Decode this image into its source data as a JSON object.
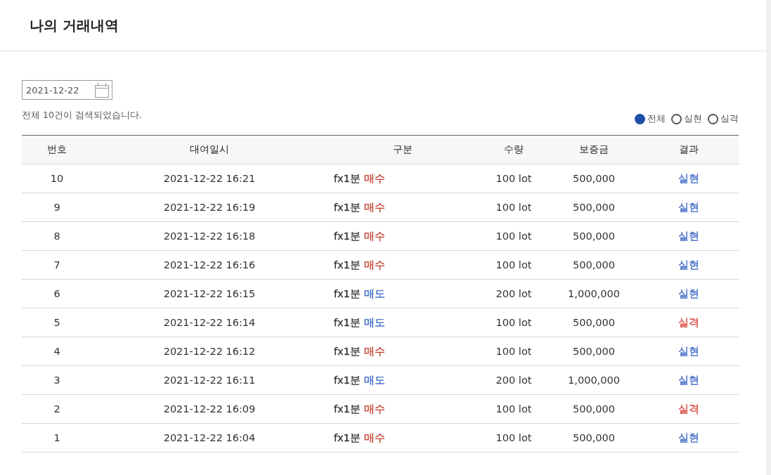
{
  "page_title": "나의 거래내역",
  "date_field": {
    "value": "2021-12-22"
  },
  "result_count": "전체 10건이 검색되었습니다.",
  "filters": [
    {
      "label": "전체",
      "selected": true
    },
    {
      "label": "실현",
      "selected": false
    },
    {
      "label": "실격",
      "selected": false
    }
  ],
  "table": {
    "columns": [
      "번호",
      "대여일시",
      "구분",
      "수량",
      "보증금",
      "결과"
    ],
    "rows": [
      {
        "no": "10",
        "time": "2021-12-22 16:21",
        "product": "fx1분",
        "side": {
          "text": "매수",
          "color": "#c0392b"
        },
        "qty": "100 lot",
        "deposit": "500,000",
        "result": {
          "text": "실현",
          "color": "#3a66c4"
        }
      },
      {
        "no": "9",
        "time": "2021-12-22 16:19",
        "product": "fx1분",
        "side": {
          "text": "매수",
          "color": "#c0392b"
        },
        "qty": "100 lot",
        "deposit": "500,000",
        "result": {
          "text": "실현",
          "color": "#3a66c4"
        }
      },
      {
        "no": "8",
        "time": "2021-12-22 16:18",
        "product": "fx1분",
        "side": {
          "text": "매수",
          "color": "#c0392b"
        },
        "qty": "100 lot",
        "deposit": "500,000",
        "result": {
          "text": "실현",
          "color": "#3a66c4"
        }
      },
      {
        "no": "7",
        "time": "2021-12-22 16:16",
        "product": "fx1분",
        "side": {
          "text": "매수",
          "color": "#c0392b"
        },
        "qty": "100 lot",
        "deposit": "500,000",
        "result": {
          "text": "실현",
          "color": "#3a66c4"
        }
      },
      {
        "no": "6",
        "time": "2021-12-22 16:15",
        "product": "fx1분",
        "side": {
          "text": "매도",
          "color": "#2f5fc2"
        },
        "qty": "200 lot",
        "deposit": "1,000,000",
        "result": {
          "text": "실현",
          "color": "#3a66c4"
        }
      },
      {
        "no": "5",
        "time": "2021-12-22 16:14",
        "product": "fx1분",
        "side": {
          "text": "매도",
          "color": "#2f5fc2"
        },
        "qty": "100 lot",
        "deposit": "500,000",
        "result": {
          "text": "실격",
          "color": "#d9413a"
        }
      },
      {
        "no": "4",
        "time": "2021-12-22 16:12",
        "product": "fx1분",
        "side": {
          "text": "매수",
          "color": "#c0392b"
        },
        "qty": "100 lot",
        "deposit": "500,000",
        "result": {
          "text": "실현",
          "color": "#3a66c4"
        }
      },
      {
        "no": "3",
        "time": "2021-12-22 16:11",
        "product": "fx1분",
        "side": {
          "text": "매도",
          "color": "#2f5fc2"
        },
        "qty": "200 lot",
        "deposit": "1,000,000",
        "result": {
          "text": "실현",
          "color": "#3a66c4"
        }
      },
      {
        "no": "2",
        "time": "2021-12-22 16:09",
        "product": "fx1분",
        "side": {
          "text": "매수",
          "color": "#c0392b"
        },
        "qty": "100 lot",
        "deposit": "500,000",
        "result": {
          "text": "실격",
          "color": "#d9413a"
        }
      },
      {
        "no": "1",
        "time": "2021-12-22 16:04",
        "product": "fx1분",
        "side": {
          "text": "매수",
          "color": "#c0392b"
        },
        "qty": "100 lot",
        "deposit": "500,000",
        "result": {
          "text": "실현",
          "color": "#3a66c4"
        }
      }
    ]
  }
}
